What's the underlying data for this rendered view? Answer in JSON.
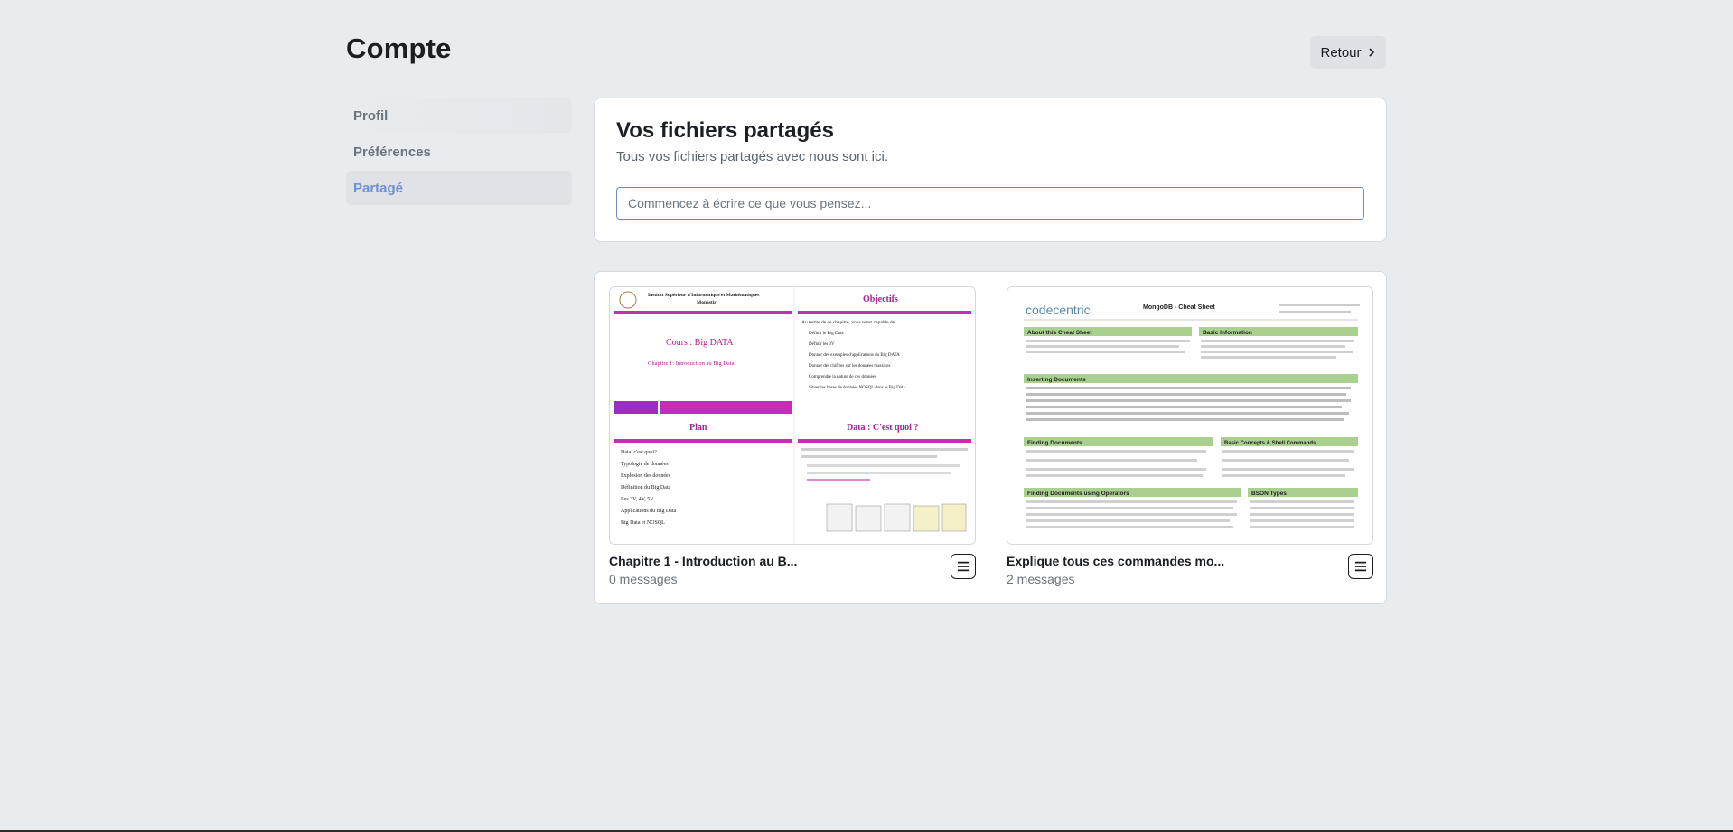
{
  "page": {
    "title": "Compte"
  },
  "header": {
    "back_label": "Retour",
    "back_icon": "chevron-right-icon"
  },
  "sidebar": {
    "items": [
      {
        "label": "Profil"
      },
      {
        "label": "Préférences"
      },
      {
        "label": "Partagé",
        "active": true
      }
    ]
  },
  "shared": {
    "title": "Vos fichiers partagés",
    "subtitle": "Tous vos fichiers partagés avec nous sont ici.",
    "search_placeholder": "Commencez à écrire ce que vous pensez..."
  },
  "files": [
    {
      "name": "Chapitre 1 - Introduction au B...",
      "messages": "0 messages",
      "preview": {
        "institute": "Institut Supérieur d'Informatique et Mathématiques",
        "city": "Monastir",
        "course": "Cours : Big DATA",
        "chapter": "Chapitre 1: Introduction au Big Data",
        "objectives_title": "Objectifs",
        "objectives_intro": "Au terme de ce chapitre, vous serez capable de:",
        "objectives": [
          "Définir le Big Data",
          "Définir les 3V",
          "Donner des exemples d'applications du Big DATA",
          "Donner des chiffres sur les données massives",
          "Comprendre la nature de ces données",
          "Situer les bases de données NOSQL dans le Big Data"
        ],
        "plan_title": "Plan",
        "plan": [
          "Data: c'est quoi?",
          "Typologie de données",
          "Explosion des données",
          "Définition du Big Data",
          "Les 3V, 4V, 5V",
          "Applications du Big Data",
          "Big Data et NOSQL"
        ],
        "data_title": "Data : C'est quoi ?"
      }
    },
    {
      "name": "Explique tous ces commandes mo...",
      "messages": "2 messages",
      "preview": {
        "logo": "codecentric",
        "title": "MongoDB - Cheat Sheet",
        "sections": [
          "About this Cheat Sheet",
          "Basic Information",
          "Inserting Documents",
          "Finding Documents",
          "Basic Concepts & Shell Commands",
          "Finding Documents using Operators",
          "BSON Types"
        ]
      }
    }
  ],
  "colors": {
    "accent": "#6f8fd8",
    "slide_magenta": "#c22fb5",
    "slide_purple": "#9b2fc4",
    "cheat_green": "#a9d08e"
  }
}
